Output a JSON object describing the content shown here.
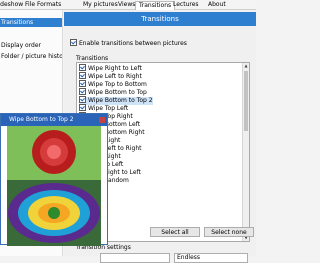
{
  "tabs": [
    {
      "label": "Slideshow"
    },
    {
      "label": "File Formats"
    },
    {
      "label": "My pictures"
    },
    {
      "label": "Views"
    },
    {
      "label": "Transitions"
    },
    {
      "label": "Lectures"
    },
    {
      "label": "About"
    }
  ],
  "sidebar": {
    "items": [
      {
        "label": "Transitions"
      },
      {
        "label": "Display order"
      },
      {
        "label": "Folder / picture history"
      }
    ]
  },
  "panel": {
    "title": "Transitions",
    "enable_checkbox_label": "Enable transitions between pictures",
    "enable_checked": true,
    "group_label": "Transitions"
  },
  "transitions": [
    {
      "label": "Wipe Right to Left",
      "checked": true
    },
    {
      "label": "Wipe Left to Right",
      "checked": true
    },
    {
      "label": "Wipe Top to Bottom",
      "checked": true
    },
    {
      "label": "Wipe Bottom to Top",
      "checked": true
    },
    {
      "label": "Wipe Bottom to Top 2",
      "checked": true
    },
    {
      "label": "Wipe Top Left",
      "checked": true
    },
    {
      "label": "Wipe Top Right",
      "checked": true
    },
    {
      "label": "Wipe Bottom Left",
      "checked": true
    },
    {
      "label": "Wipe Bottom Right",
      "checked": true
    },
    {
      "label": "Slide Right",
      "checked": true
    },
    {
      "label": "Slide Left to Right",
      "checked": true
    },
    {
      "label": "Wipe Right",
      "checked": true
    },
    {
      "label": "Fade to Left",
      "checked": true
    },
    {
      "label": "Fade Right to Left",
      "checked": true
    },
    {
      "label": "Fade Random",
      "checked": true
    }
  ],
  "preview": {
    "title": "Wipe Bottom to Top 2"
  },
  "buttons": {
    "select_all": "Select all",
    "select_none": "Select none"
  },
  "duration": {
    "label": "Transition settings",
    "speed_value": "",
    "mode_value": "Endless"
  }
}
